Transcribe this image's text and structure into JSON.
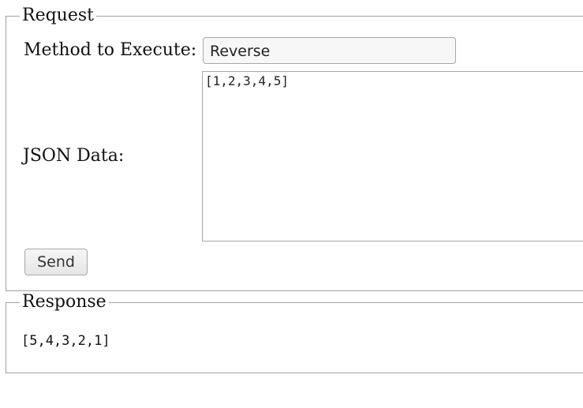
{
  "request": {
    "legend": "Request",
    "method_label": "Method to Execute:",
    "method_value": "Reverse",
    "json_label": "JSON Data:",
    "json_value": "[1,2,3,4,5]",
    "send_label": "Send"
  },
  "response": {
    "legend": "Response",
    "output": "[5,4,3,2,1]"
  }
}
